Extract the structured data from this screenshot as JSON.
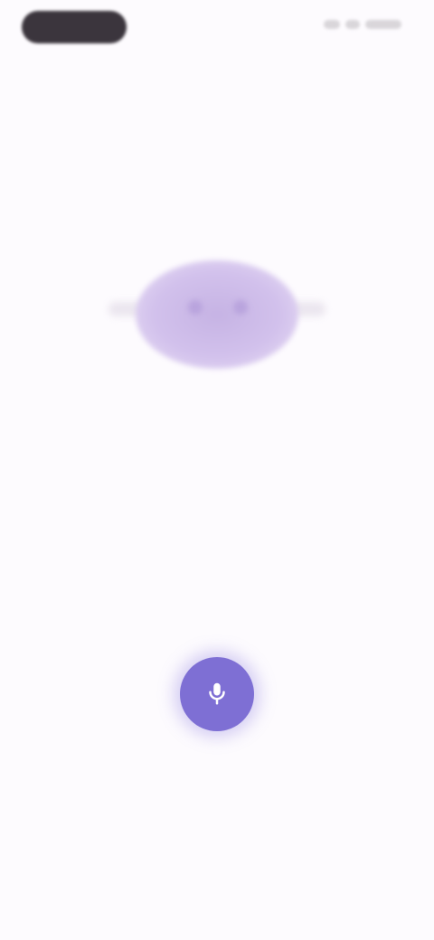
{
  "app": {
    "accent": "#7e6fd4",
    "background": "#fdfbfe",
    "orb_color": "#c6b3e4"
  },
  "status_bar": {
    "time_pill_icon": "status-pill-icon",
    "system_icons": "system-status-icons"
  },
  "hero": {
    "icon": "listening-orb-icon"
  },
  "header": {
    "title": "",
    "subtitle": ""
  },
  "mic": {
    "icon": "microphone-icon"
  },
  "footer": {
    "hint": ""
  }
}
